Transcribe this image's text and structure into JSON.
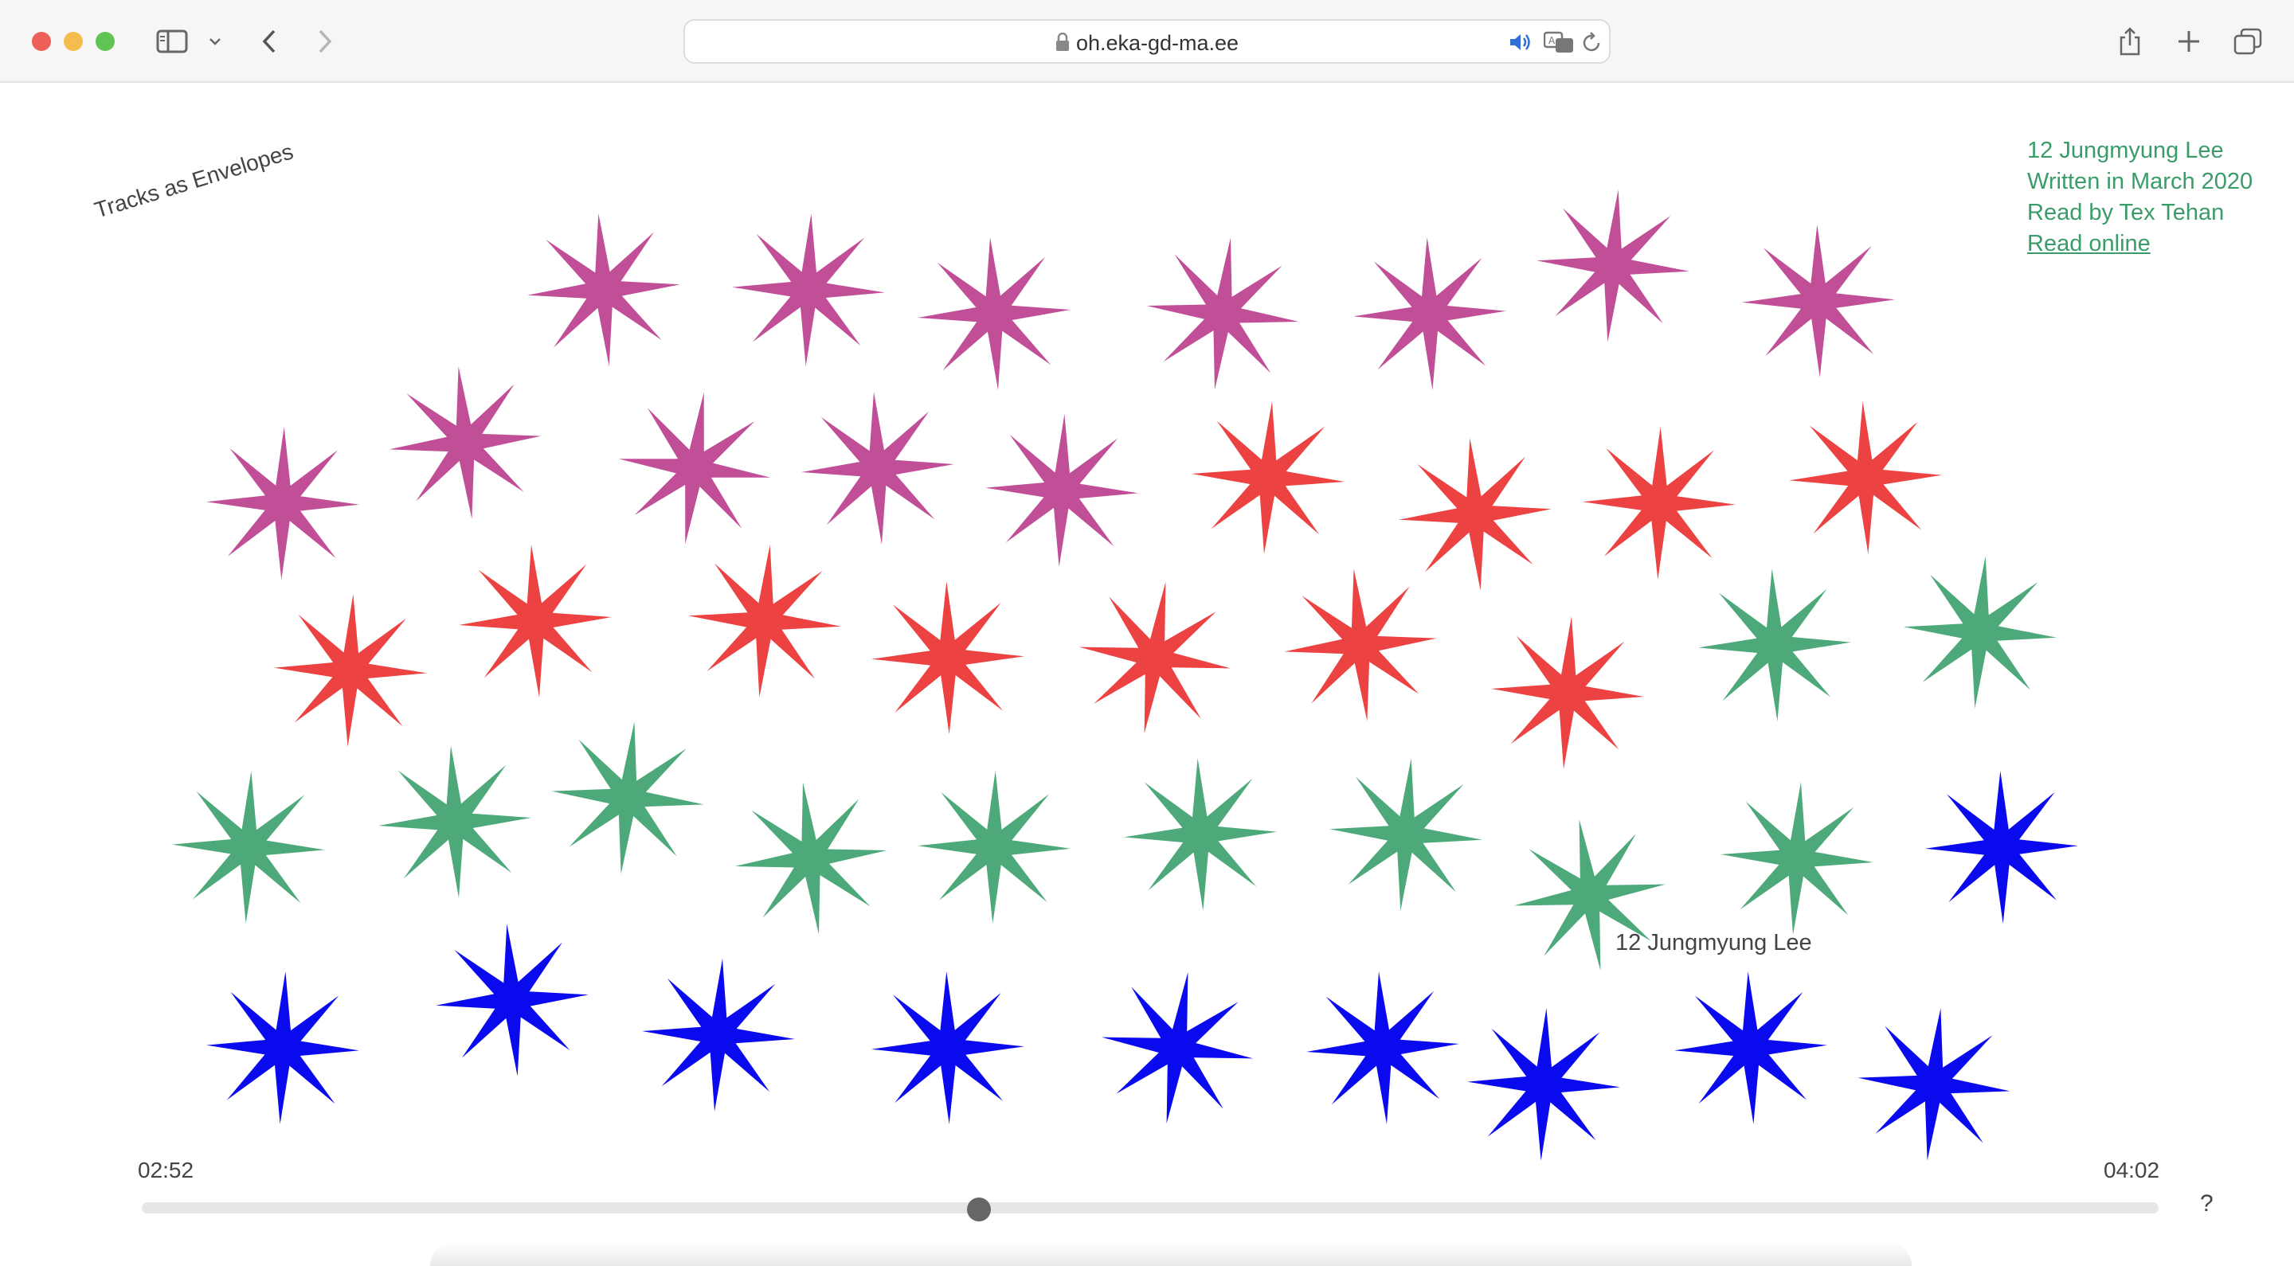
{
  "browser": {
    "url": "oh.eka-gd-ma.ee",
    "icons": [
      "sidebar-icon",
      "chevron-down-icon",
      "back-icon",
      "forward-icon",
      "lock-icon",
      "audio-icon",
      "translate-icon",
      "reload-icon",
      "share-icon",
      "new-tab-icon",
      "tabs-overview-icon"
    ]
  },
  "page": {
    "title": "Tracks as Envelopes",
    "credits": {
      "line1": "12 Jungmyung Lee",
      "line2": "Written in March 2020",
      "line3": "Read by Tex Tehan",
      "link": "Read online"
    },
    "hover_label": "12 Jungmyung Lee",
    "help": "?"
  },
  "player": {
    "elapsed": "02:52",
    "total": "04:02",
    "progress": 0.415
  },
  "colors": {
    "purple": "#c14f97",
    "red": "#ec4242",
    "green": "#4ea97a",
    "blue": "#0a0aee",
    "link": "#3a9c68"
  }
}
